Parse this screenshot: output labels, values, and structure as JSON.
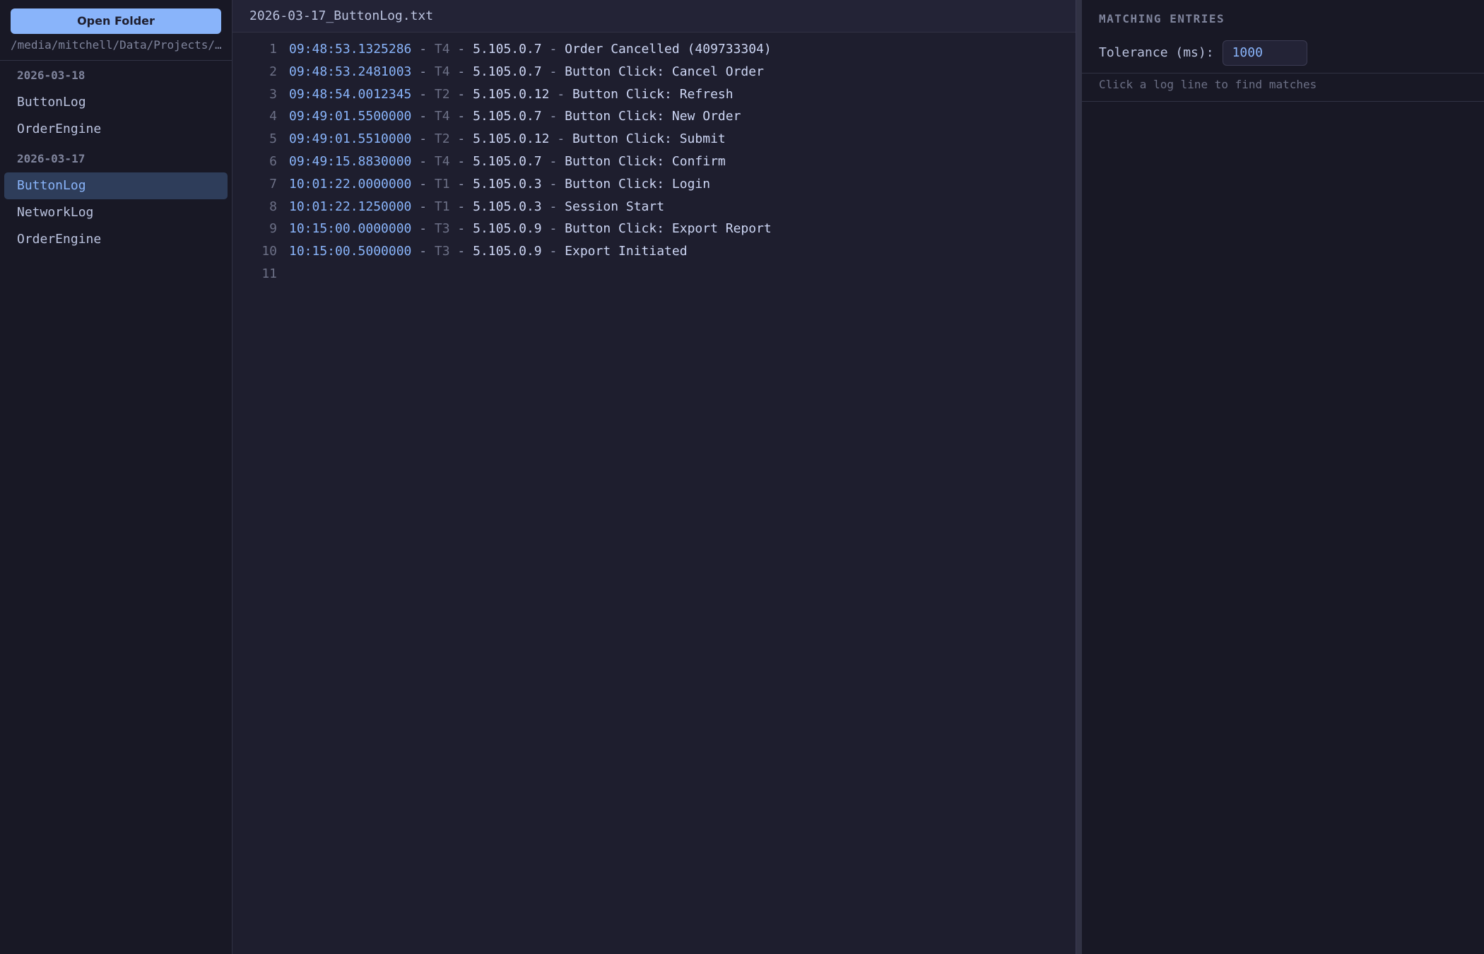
{
  "sidebar": {
    "open_folder_label": "Open Folder",
    "folder_path": "/media/mitchell/Data/Projects/LogViewer/logs",
    "groups": [
      {
        "date": "2026-03-18",
        "files": [
          "ButtonLog",
          "OrderEngine"
        ]
      },
      {
        "date": "2026-03-17",
        "files": [
          "ButtonLog",
          "NetworkLog",
          "OrderEngine"
        ]
      }
    ],
    "active_file": "2026-03-17/ButtonLog"
  },
  "editor": {
    "tab_title": "2026-03-17_ButtonLog.txt",
    "lines": [
      {
        "no": "1",
        "ts": "09:48:53.1325286",
        "thread": "T4",
        "version": "5.105.0.7",
        "message": "Order Cancelled (409733304)"
      },
      {
        "no": "2",
        "ts": "09:48:53.2481003",
        "thread": "T4",
        "version": "5.105.0.7",
        "message": "Button Click: Cancel Order"
      },
      {
        "no": "3",
        "ts": "09:48:54.0012345",
        "thread": "T2",
        "version": "5.105.0.12",
        "message": "Button Click: Refresh"
      },
      {
        "no": "4",
        "ts": "09:49:01.5500000",
        "thread": "T4",
        "version": "5.105.0.7",
        "message": "Button Click: New Order"
      },
      {
        "no": "5",
        "ts": "09:49:01.5510000",
        "thread": "T2",
        "version": "5.105.0.12",
        "message": "Button Click: Submit"
      },
      {
        "no": "6",
        "ts": "09:49:15.8830000",
        "thread": "T4",
        "version": "5.105.0.7",
        "message": "Button Click: Confirm"
      },
      {
        "no": "7",
        "ts": "10:01:22.0000000",
        "thread": "T1",
        "version": "5.105.0.3",
        "message": "Button Click: Login"
      },
      {
        "no": "8",
        "ts": "10:01:22.1250000",
        "thread": "T1",
        "version": "5.105.0.3",
        "message": "Session Start"
      },
      {
        "no": "9",
        "ts": "10:15:00.0000000",
        "thread": "T3",
        "version": "5.105.0.9",
        "message": "Button Click: Export Report"
      },
      {
        "no": "10",
        "ts": "10:15:00.5000000",
        "thread": "T3",
        "version": "5.105.0.9",
        "message": "Export Initiated"
      },
      {
        "no": "11",
        "ts": "",
        "thread": "",
        "version": "",
        "message": ""
      }
    ]
  },
  "matches": {
    "header": "MATCHING ENTRIES",
    "tolerance_label": "Tolerance (ms):",
    "tolerance_value": "1000",
    "hint": "Click a log line to find matches"
  },
  "colors": {
    "accent": "#89b4fa",
    "background": "#1e1e2e",
    "sidebar_bg": "#181825",
    "active_item_bg": "#2e3d5a"
  }
}
